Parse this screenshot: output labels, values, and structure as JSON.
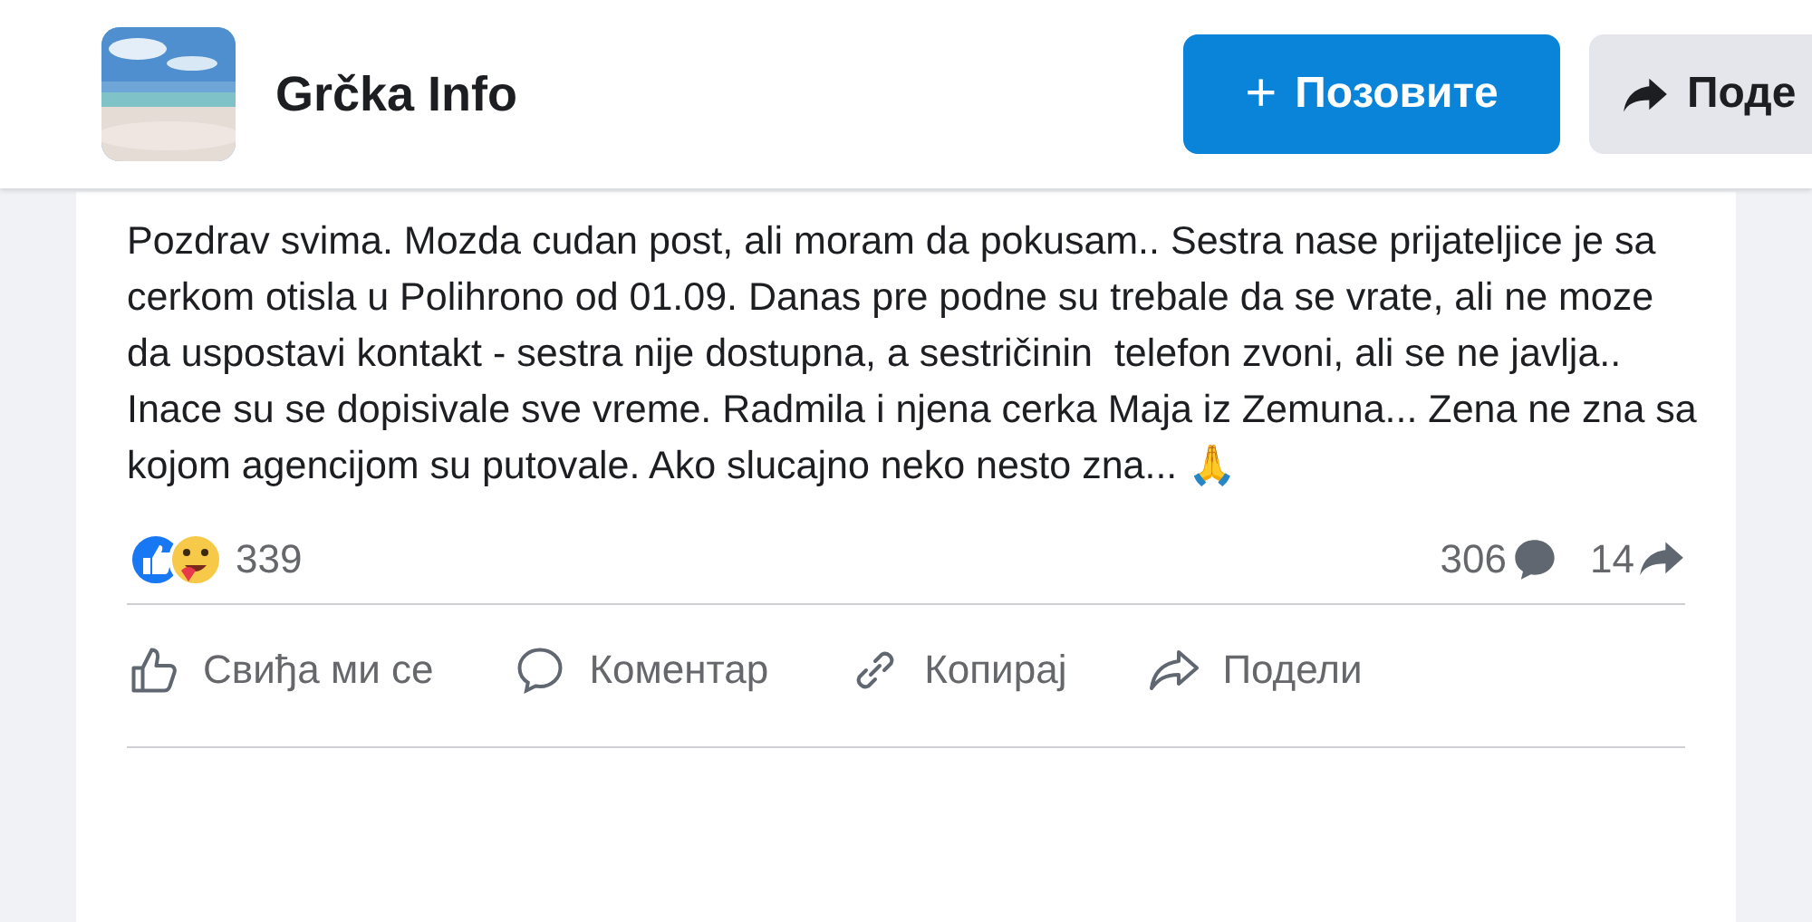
{
  "page_header": {
    "title": "Grčka Info",
    "invite_button": {
      "icon": "+",
      "label": "Позовите"
    },
    "share_button": {
      "label": "Поде"
    }
  },
  "post": {
    "text": "Pozdrav svima. Mozda cudan post, ali moram da pokusam.. Sestra nase prijateljice je sa cerkom otisla u Polihrono od 01.09. Danas pre podne su trebale da se vrate, ali ne moze da uspostavi kontakt - sestra nije dostupna, a sestričinin  telefon zvoni, ali se ne javlja.. Inace su se dopisivale sve vreme. Radmila i njena cerka Maja iz Zemuna... Zena ne zna sa kojom agencijom su putovale. Ako slucajno neko nesto zna... 🙏",
    "reactions_count": "339",
    "comments_count": "306",
    "shares_count": "14",
    "actions": [
      {
        "kind": "like",
        "label": "Свиђа ми се"
      },
      {
        "kind": "comment",
        "label": "Коментар"
      },
      {
        "kind": "copy",
        "label": "Копирај"
      },
      {
        "kind": "share",
        "label": "Подели"
      }
    ]
  }
}
